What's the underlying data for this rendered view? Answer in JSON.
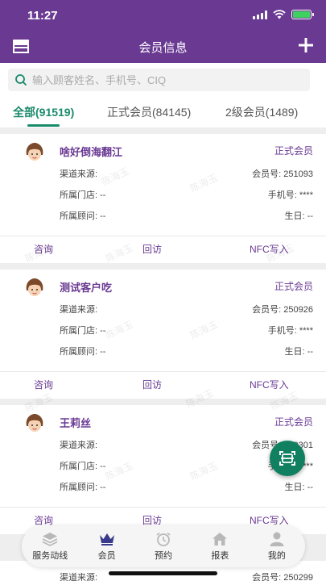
{
  "status": {
    "time": "11:27"
  },
  "nav": {
    "title": "会员信息"
  },
  "search": {
    "placeholder": "输入顾客姓名、手机号、CIQ"
  },
  "tabs": [
    {
      "label": "全部(91519)"
    },
    {
      "label": "正式会员(84145)"
    },
    {
      "label": "2级会员(1489)"
    }
  ],
  "labels": {
    "channel": "渠道来源:",
    "store": "所属门店:",
    "advisor": "所属顾问:",
    "member_no": "会员号:",
    "phone": "手机号:",
    "birthday": "生日:",
    "consult": "咨询",
    "revisit": "回访",
    "nfc": "NFC写入"
  },
  "members": [
    {
      "name": "啥好倒海翻江",
      "type": "正式会员",
      "store": "--",
      "advisor": "--",
      "member_no": "251093",
      "phone": "****",
      "birthday": "--"
    },
    {
      "name": "测试客户吃",
      "type": "正式会员",
      "store": "--",
      "advisor": "--",
      "member_no": "250926",
      "phone": "****",
      "birthday": "--"
    },
    {
      "name": "王莉丝",
      "type": "正式会员",
      "store": "--",
      "advisor": "--",
      "member_no": "250301",
      "phone": "****",
      "birthday": "--"
    }
  ],
  "peek": {
    "channel": "渠道来源:",
    "member_no": "会员号:",
    "member_no_value": "250299"
  },
  "watermark": "陈海玉",
  "tabbar": [
    {
      "label": "服务动线",
      "icon": "layers-icon"
    },
    {
      "label": "会员",
      "icon": "crown-icon"
    },
    {
      "label": "预约",
      "icon": "clock-icon"
    },
    {
      "label": "报表",
      "icon": "home-icon"
    },
    {
      "label": "我的",
      "icon": "user-icon"
    }
  ],
  "colors": {
    "primary": "#6a3a93",
    "accent": "#1a8a6b",
    "fab": "#118060"
  }
}
